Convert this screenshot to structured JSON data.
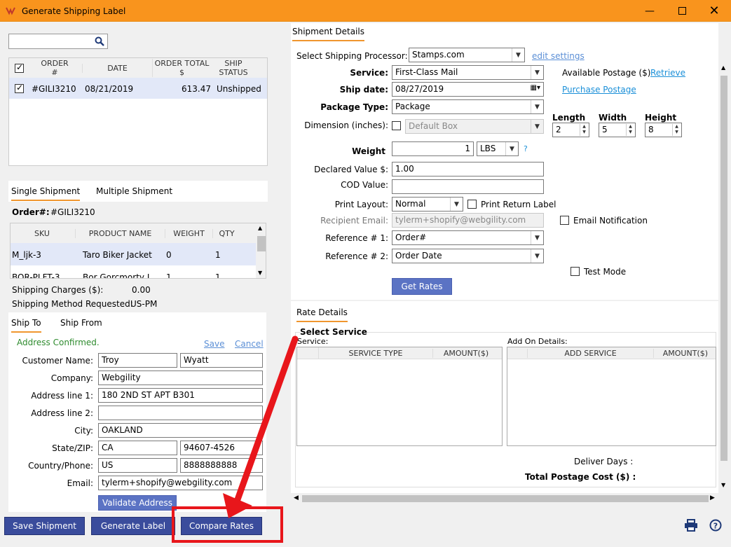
{
  "window": {
    "title": "Generate Shipping Label",
    "min_icon": "minimize-icon",
    "max_icon": "maximize-icon",
    "close_icon": "close-icon"
  },
  "orders": {
    "columns": [
      "ORDER #",
      "DATE",
      "ORDER TOTAL $",
      "SHIP STATUS"
    ],
    "rows": [
      {
        "order": "#GILI3210",
        "date": "08/21/2019",
        "total": "613.47",
        "status": "Unshipped"
      }
    ]
  },
  "shipment_tabs": {
    "single": "Single Shipment",
    "multiple": "Multiple Shipment"
  },
  "order_label": "Order#:",
  "order_value": "#GILI3210",
  "items": {
    "columns": [
      "SKU",
      "PRODUCT NAME",
      "WEIGHT",
      "QTY"
    ],
    "rows": [
      {
        "sku": "M_ljk-3",
        "name": "Taro Biker Jacket",
        "weight": "0",
        "qty": "1"
      },
      {
        "sku": "BOR-PLFT-3",
        "name": "Bor Gorcmorty I",
        "weight": "1",
        "qty": "1"
      }
    ]
  },
  "charges": {
    "label": "Shipping Charges ($):",
    "value": "0.00",
    "method_label": "Shipping Method Requested:",
    "method_value": "US-PM"
  },
  "address_tabs": {
    "ship_to": "Ship To",
    "ship_from": "Ship From"
  },
  "address": {
    "status": "Address Confirmed.",
    "save": "Save",
    "cancel": "Cancel",
    "customer_label": "Customer Name:",
    "first": "Troy",
    "last": "Wyatt",
    "company_label": "Company:",
    "company": "Webgility",
    "addr1_label": "Address line 1:",
    "addr1": "180 2ND ST APT B301",
    "addr2_label": "Address line 2:",
    "addr2": "",
    "city_label": "City:",
    "city": "OAKLAND",
    "state_label": "State/ZIP:",
    "state": "CA",
    "zip": "94607-4526",
    "country_label": "Country/Phone:",
    "country": "US",
    "phone": "8888888888",
    "email_label": "Email:",
    "email": "tylerm+shopify@webgility.com",
    "validate": "Validate Address"
  },
  "buttons": {
    "save_shipment": "Save Shipment",
    "generate_label": "Generate Label",
    "compare_rates": "Compare Rates"
  },
  "details": {
    "tab": "Shipment Details",
    "processor_label": "Select Shipping Processor:",
    "processor": "Stamps.com",
    "edit_settings": "edit settings",
    "service_label": "Service:",
    "service": "First-Class Mail",
    "postage_label": "Available Postage ($)",
    "retrieve": "Retrieve",
    "ship_date_label": "Ship date:",
    "ship_date": "08/27/2019",
    "purchase": "Purchase Postage",
    "package_label": "Package Type:",
    "package": "Package",
    "length_label": "Length",
    "length": "2",
    "width_label": "Width",
    "width": "5",
    "height_label": "Height",
    "height": "8",
    "dimension_label": "Dimension (inches):",
    "dimension": "Default Box",
    "weight_label": "Weight",
    "weight": "1",
    "weight_unit": "LBS",
    "help": "?",
    "declared_label": "Declared Value $:",
    "declared": "1.00",
    "cod_label": "COD Value:",
    "cod": "",
    "layout_label": "Print Layout:",
    "layout": "Normal",
    "return_label": "Print Return Label",
    "recipient_label": "Recipient Email:",
    "recipient": "tylerm+shopify@webgility.com",
    "email_notif": "Email Notification",
    "ref1_label": "Reference # 1:",
    "ref1": "Order#",
    "ref2_label": "Reference # 2:",
    "ref2": "Order Date",
    "test_mode": "Test Mode",
    "get_rates": "Get Rates"
  },
  "rates": {
    "tab": "Rate Details",
    "select_service": "Select Service",
    "service_label": "Service:",
    "addon_label": "Add On Details:",
    "service_cols": [
      "SERVICE TYPE",
      "AMOUNT($)"
    ],
    "addon_cols": [
      "ADD SERVICE",
      "AMOUNT($)"
    ],
    "deliver_days": "Deliver Days :",
    "total_cost": "Total Postage Cost ($) :"
  },
  "colors": {
    "titlebar": "#f9941d",
    "button": "#3a4c9c",
    "link": "#1a8fd8",
    "highlight": "#e2e8f8",
    "annotation": "#e8161b"
  }
}
